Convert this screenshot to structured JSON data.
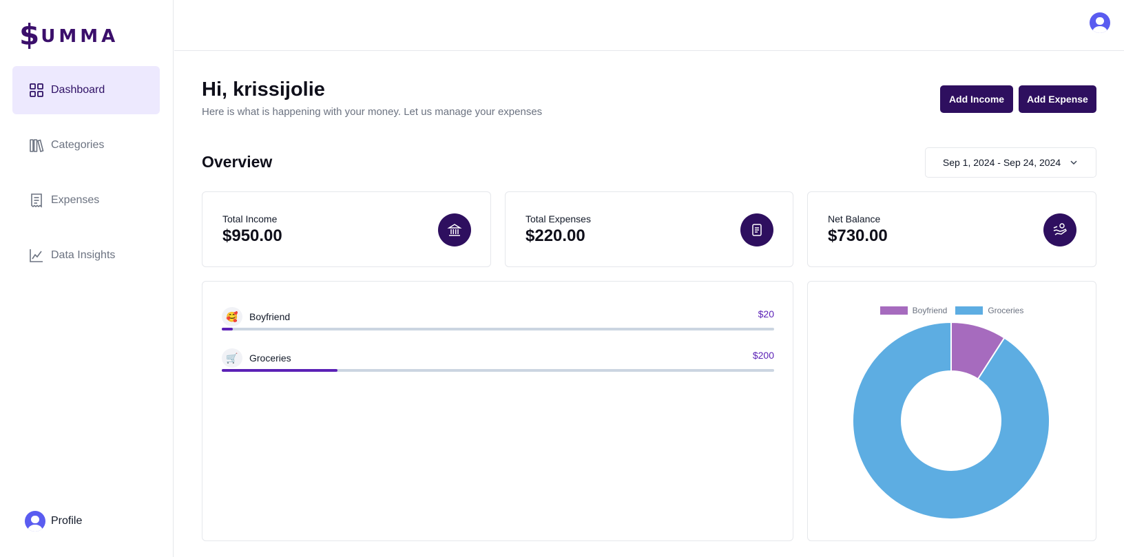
{
  "brand": {
    "dollar": "$",
    "name": "UMMA",
    "color": "#3b0f6b"
  },
  "sidebar": {
    "items": [
      {
        "label": "Dashboard",
        "icon": "grid-icon",
        "active": true
      },
      {
        "label": "Categories",
        "icon": "library-icon",
        "active": false
      },
      {
        "label": "Expenses",
        "icon": "receipt-icon",
        "active": false
      },
      {
        "label": "Data Insights",
        "icon": "line-chart-icon",
        "active": false
      }
    ],
    "profile_label": "Profile"
  },
  "header": {
    "greeting": "Hi, krissijolie",
    "subtitle": "Here is what is happening with your money. Let us manage your expenses",
    "add_income_label": "Add Income",
    "add_expense_label": "Add Expense"
  },
  "overview": {
    "title": "Overview",
    "date_range": "Sep 1, 2024 - Sep 24, 2024",
    "stats": [
      {
        "label": "Total Income",
        "value": "$950.00",
        "icon": "bank-icon"
      },
      {
        "label": "Total Expenses",
        "value": "$220.00",
        "icon": "receipt-icon"
      },
      {
        "label": "Net Balance",
        "value": "$730.00",
        "icon": "hand-coins-icon"
      }
    ]
  },
  "categories": [
    {
      "name": "Boyfriend",
      "emoji": "🥰",
      "amount": "$20",
      "progress": 0.02
    },
    {
      "name": "Groceries",
      "emoji": "🛒",
      "amount": "$200",
      "progress": 0.21
    }
  ],
  "colors": {
    "accent": "#2e0f5f",
    "active_bg": "#ede9fe",
    "progress": "#5b21b6",
    "track": "#cbd5e1"
  },
  "chart_data": {
    "type": "pie",
    "donut": true,
    "categories": [
      "Boyfriend",
      "Groceries"
    ],
    "values": [
      20,
      200
    ],
    "colors": [
      "#a66bbe",
      "#5dade2"
    ],
    "legend": "top"
  }
}
